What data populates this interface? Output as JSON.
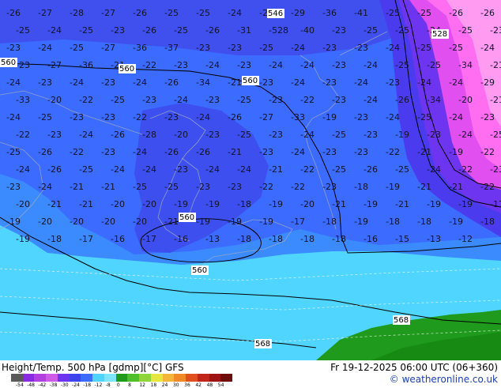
{
  "map": {
    "background_colors": {
      "ocean_fill": "#4fd5ff",
      "cold_blue": "#3b6bff",
      "deep_blue": "#3d44ee",
      "violet": "#6e35f0",
      "magenta": "#ff4fe8",
      "pink": "#ff9cf2",
      "green": "#1f9a1c"
    },
    "temperature_labels": [
      "-26",
      "-27",
      "-28",
      "-27",
      "-26",
      "-25",
      "-25",
      "-24",
      "-28",
      "-29",
      "-36",
      "-41",
      "-25",
      "-25",
      "-26",
      "-26",
      "-25",
      "-24",
      "-25",
      "-23",
      "-26",
      "-25",
      "-26",
      "-31",
      "-528",
      "-40",
      "-23",
      "-25",
      "-25",
      "-24",
      "-25",
      "-23",
      "-23",
      "-24",
      "-25",
      "-27",
      "-36",
      "-37",
      "-23",
      "-23",
      "-25",
      "-24",
      "-23",
      "-23",
      "-24",
      "-25",
      "-25",
      "-24",
      "-23",
      "-27",
      "-36",
      "-21",
      "-22",
      "-23",
      "-24",
      "-23",
      "-24",
      "-24",
      "-23",
      "-24",
      "-25",
      "-25",
      "-34",
      "-21",
      "-24",
      "-23",
      "-24",
      "-23",
      "-24",
      "-26",
      "-34",
      "-21",
      "-23",
      "-24",
      "-23",
      "-24",
      "-23",
      "-24",
      "-24",
      "-29",
      "-33",
      "-20",
      "-22",
      "-25",
      "-23",
      "-24",
      "-23",
      "-25",
      "-23",
      "-22",
      "-23",
      "-24",
      "-26",
      "-34",
      "-20",
      "-21",
      "-24",
      "-25",
      "-23",
      "-23",
      "-22",
      "-23",
      "-24",
      "-26",
      "-27",
      "-33",
      "-19",
      "-23",
      "-24",
      "-25",
      "-24",
      "-23",
      "-22",
      "-23",
      "-24",
      "-26",
      "-28",
      "-20",
      "-23",
      "-25",
      "-23",
      "-24",
      "-25",
      "-23",
      "-19",
      "-23",
      "-24",
      "-25",
      "-25",
      "-26",
      "-22",
      "-23",
      "-24",
      "-26",
      "-26",
      "-21",
      "-23",
      "-24",
      "-23",
      "-23",
      "-22",
      "-21",
      "-19",
      "-22",
      "-24",
      "-26",
      "-25",
      "-24",
      "-24",
      "-23",
      "-24",
      "-24",
      "-21",
      "-22",
      "-25",
      "-26",
      "-25",
      "-24",
      "-22",
      "-23",
      "-23",
      "-24",
      "-21",
      "-21",
      "-25",
      "-25",
      "-23",
      "-23",
      "-22",
      "-22",
      "-23",
      "-18",
      "-19",
      "-21",
      "-21",
      "-22",
      "-20",
      "-21",
      "-21",
      "-20",
      "-20",
      "-19",
      "-19",
      "-18",
      "-19",
      "-20",
      "-21",
      "-19",
      "-21",
      "-19",
      "-19",
      "-17",
      "-19",
      "-20",
      "-20",
      "-20",
      "-20",
      "-21",
      "-19",
      "-19",
      "-19",
      "-17",
      "-18",
      "-19",
      "-18",
      "-18",
      "-19",
      "-18",
      "-19",
      "-18",
      "-17",
      "-16",
      "-17",
      "-16",
      "-13",
      "-18",
      "-18",
      "-18",
      "-18",
      "-16",
      "-15",
      "-13",
      "-12"
    ],
    "height_labels": [
      "560",
      "560",
      "560",
      "560",
      "560",
      "568",
      "568",
      "528",
      "546"
    ]
  },
  "footer": {
    "title": "Height/Temp. 500 hPa [gdmp][°C] GFS",
    "valid": "Fr 19-12-2025 06:00 UTC (06+360)",
    "copyright": "© weatheronline.co.uk",
    "scale_ticks": [
      "-54",
      "-48",
      "-42",
      "-38",
      "-30",
      "-24",
      "-18",
      "-12",
      "-8",
      "0",
      "8",
      "12",
      "18",
      "24",
      "30",
      "36",
      "42",
      "48",
      "54"
    ],
    "scale_colors": [
      "#5a5a5a",
      "#8a2be2",
      "#b23fe0",
      "#cf5ae8",
      "#6e35f0",
      "#3d44ee",
      "#3b6bff",
      "#4fd5ff",
      "#7ee5ff",
      "#1f9a1c",
      "#4fbf2b",
      "#8fd43a",
      "#e6e640",
      "#f3b53a",
      "#f08a28",
      "#e0501e",
      "#c2261a",
      "#9e1414",
      "#6e0c0c"
    ]
  }
}
